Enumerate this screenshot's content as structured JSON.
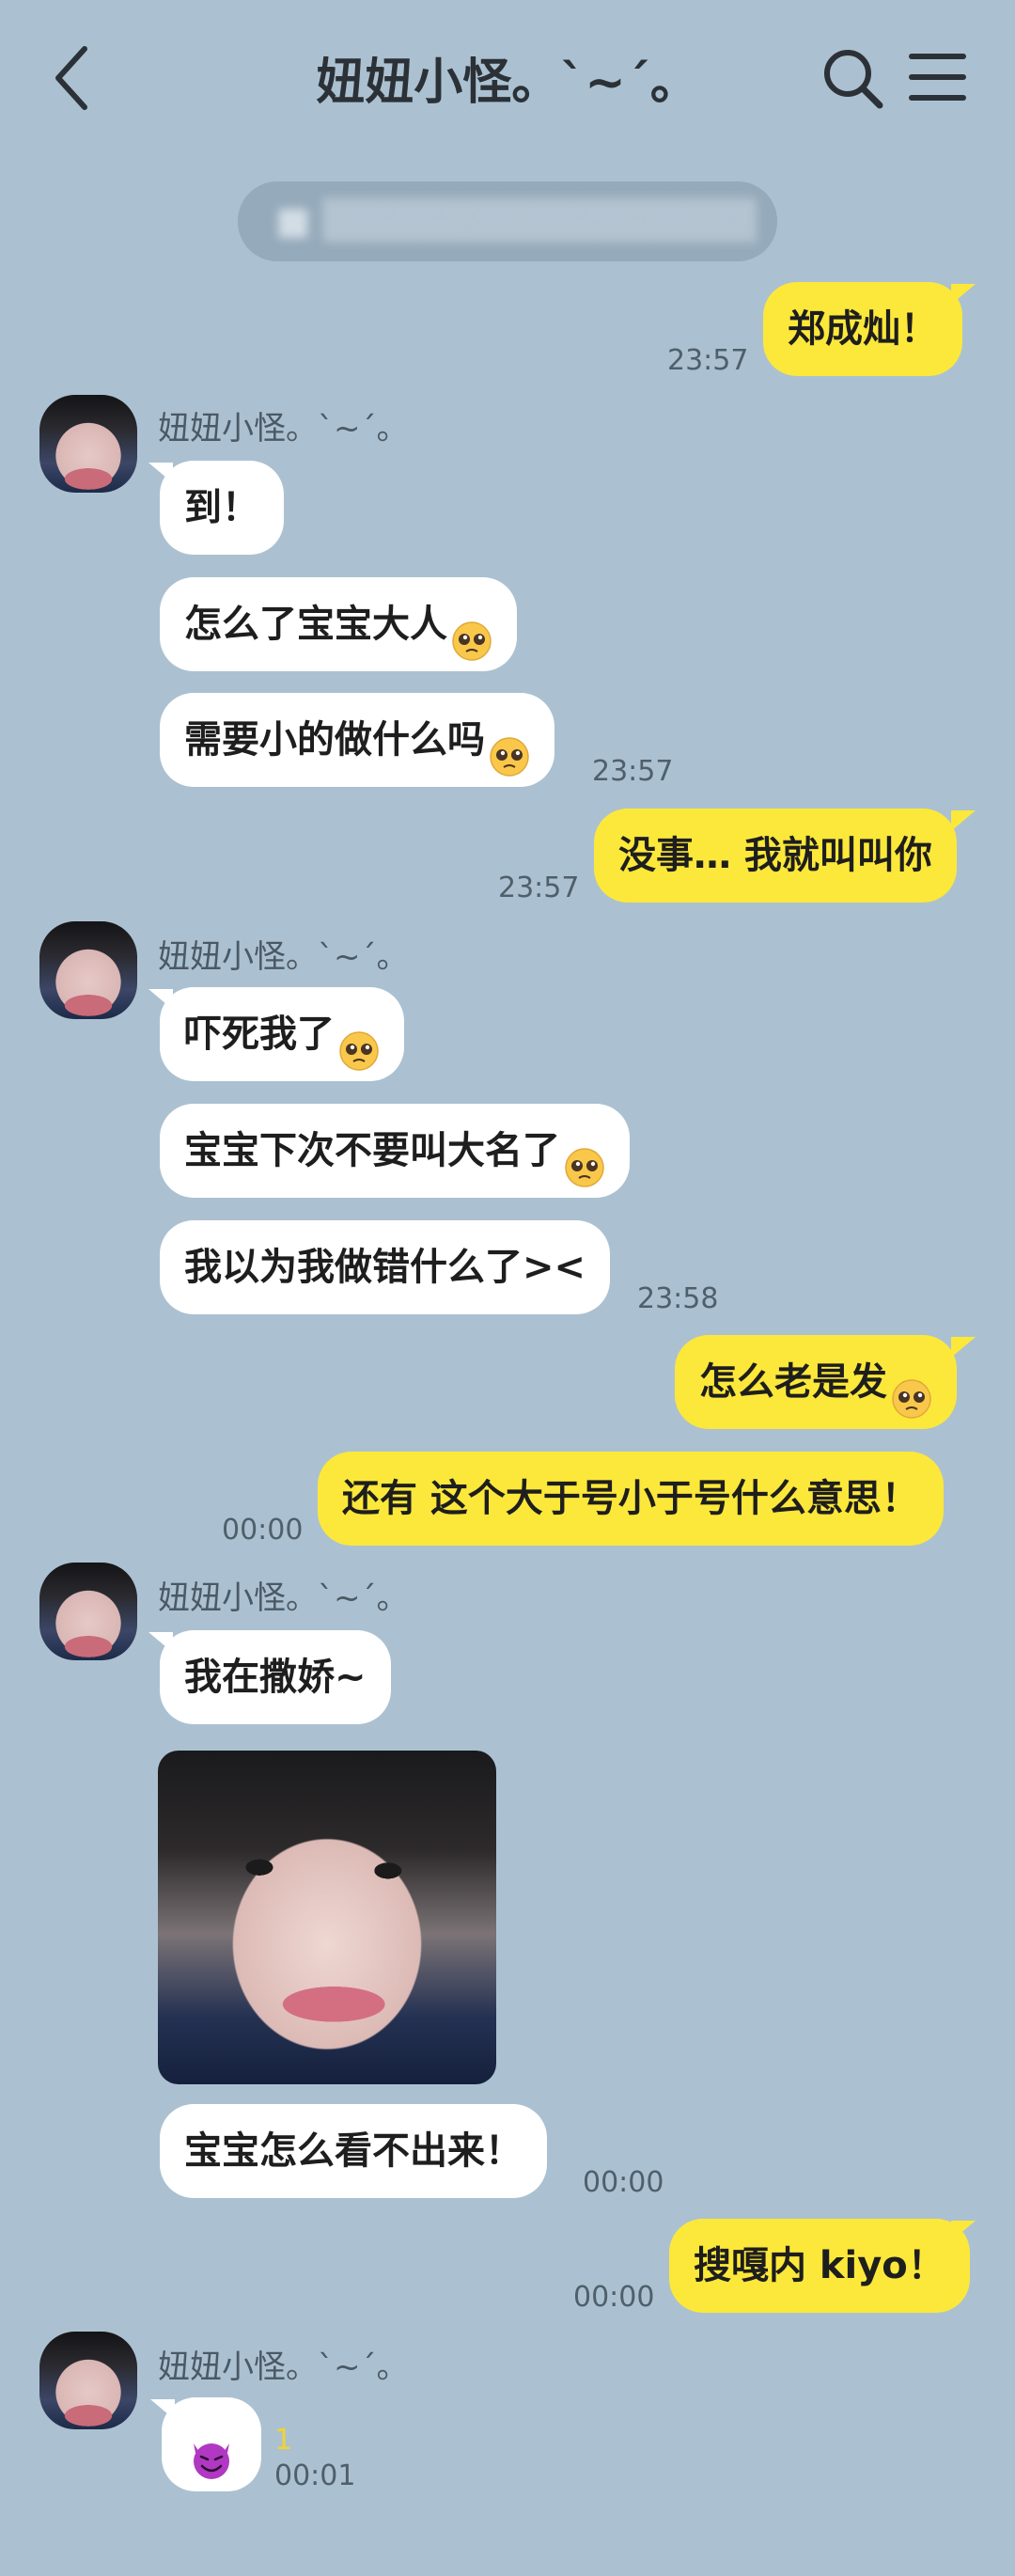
{
  "header": {
    "title": "妞妞小怪。`~´。"
  },
  "notice": {
    "text": "■ ▒▒▒▒▒▒▒▒▒▒▒▒▒▒▒"
  },
  "contact": {
    "name": "妞妞小怪。`~´。"
  },
  "messages": [
    {
      "from": "me",
      "text": "郑成灿！",
      "time": "23:57"
    },
    {
      "from": "them",
      "text": "到！"
    },
    {
      "from": "them",
      "text": "怎么了宝宝大人",
      "emoji": "pleading-face"
    },
    {
      "from": "them",
      "text": "需要小的做什么吗",
      "emoji": "pleading-face",
      "time": "23:57"
    },
    {
      "from": "me",
      "text": "没事… 我就叫叫你",
      "time": "23:57"
    },
    {
      "from": "them",
      "text": "吓死我了",
      "emoji": "pleading-face"
    },
    {
      "from": "them",
      "text": "宝宝下次不要叫大名了",
      "emoji": "pleading-face"
    },
    {
      "from": "them",
      "text": "我以为我做错什么了><",
      "time": "23:58"
    },
    {
      "from": "me",
      "text": "怎么老是发",
      "emoji": "pleading-face"
    },
    {
      "from": "me",
      "text": "还有 这个大于号小于号什么意思！",
      "time": "00:00"
    },
    {
      "from": "them",
      "text": "我在撒娇~"
    },
    {
      "from": "them",
      "type": "photo",
      "image": "selfie-photo"
    },
    {
      "from": "them",
      "text": "宝宝怎么看不出来！",
      "time": "00:00"
    },
    {
      "from": "me",
      "text": "搜嘎内 kiyo！",
      "time": "00:00"
    },
    {
      "from": "them",
      "type": "emoticon",
      "emoji": "smiling-devil",
      "unread": "1",
      "time": "00:01"
    }
  ],
  "colors": {
    "background": "#abc1d1",
    "outgoing": "#fce83a",
    "incoming": "#ffffff"
  }
}
